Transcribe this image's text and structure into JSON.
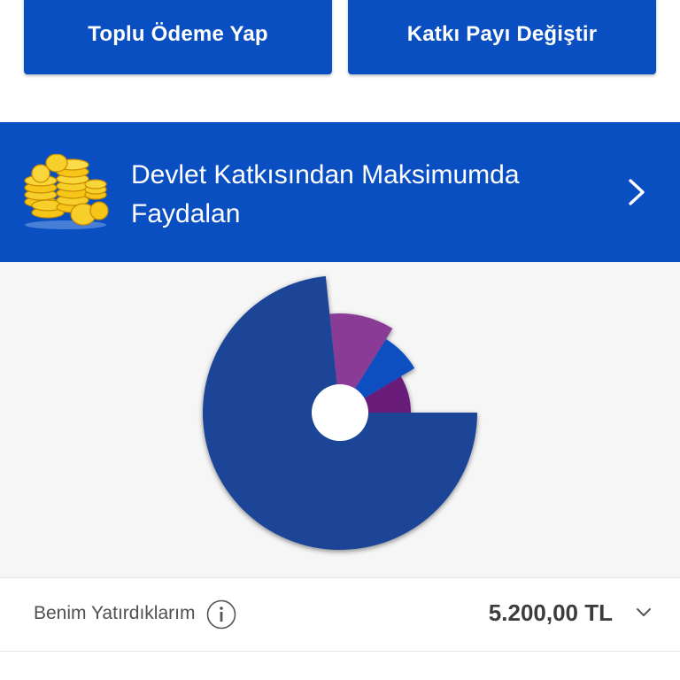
{
  "actions": {
    "bulk_payment_label": "Toplu Ödeme Yap",
    "change_contribution_label": "Katkı Payı Değiştir"
  },
  "banner": {
    "title": "Devlet Katkısından Maksimumda Faydalan",
    "icon": "gold-coins-icon",
    "chevron": "chevron-right-icon"
  },
  "chart_data": {
    "type": "pie",
    "style": "variable-radius",
    "slices": [
      {
        "share": 0.75,
        "color": "#1a4598"
      },
      {
        "share": 0.1,
        "color": "#8a3b96"
      },
      {
        "share": 0.07,
        "color": "#0a4fc1"
      },
      {
        "share": 0.08,
        "color": "#6b1f7a"
      }
    ]
  },
  "summary": {
    "label": "Benim Yatırdıklarım",
    "value": "5.200,00 TL",
    "info_icon": "info-icon",
    "chevron": "chevron-down-icon"
  },
  "colors": {
    "primary": "#0a4fc1",
    "chart_background": "#f6f6f6"
  }
}
